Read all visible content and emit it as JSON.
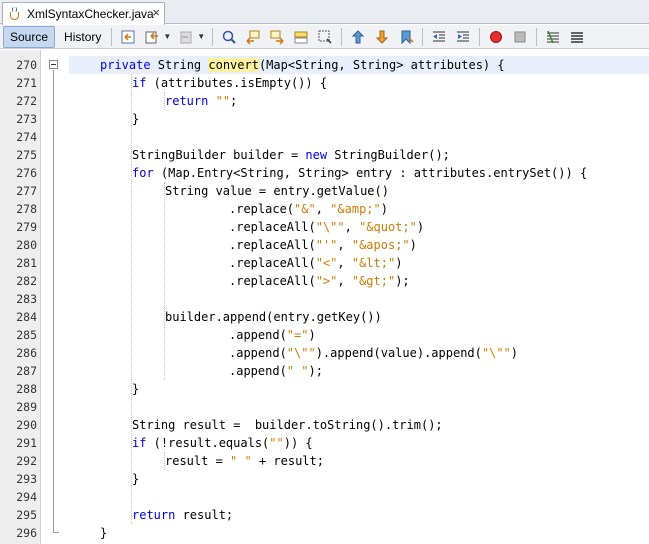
{
  "tab": {
    "title": "XmlSyntaxChecker.java",
    "close": "×"
  },
  "toolbar": {
    "source_label": "Source",
    "history_label": "History"
  },
  "editor": {
    "lines": [
      {
        "n": "270",
        "indent": 1,
        "tokens": [
          [
            "kw",
            "private"
          ],
          [
            "t",
            " String "
          ],
          [
            "hl",
            "convert"
          ],
          [
            "t",
            "(Map<String, String> attributes) {"
          ]
        ]
      },
      {
        "n": "271",
        "indent": 2,
        "tokens": [
          [
            "kw",
            "if"
          ],
          [
            "t",
            " (attributes.isEmpty()) {"
          ]
        ]
      },
      {
        "n": "272",
        "indent": 3,
        "tokens": [
          [
            "kw",
            "return"
          ],
          [
            "t",
            " "
          ],
          [
            "str",
            "\"\""
          ],
          [
            "t",
            ";"
          ]
        ]
      },
      {
        "n": "273",
        "indent": 2,
        "tokens": [
          [
            "t",
            "}"
          ]
        ]
      },
      {
        "n": "274",
        "indent": 0,
        "tokens": []
      },
      {
        "n": "275",
        "indent": 2,
        "tokens": [
          [
            "t",
            "StringBuilder builder = "
          ],
          [
            "kw",
            "new"
          ],
          [
            "t",
            " StringBuilder();"
          ]
        ]
      },
      {
        "n": "276",
        "indent": 2,
        "tokens": [
          [
            "kw",
            "for"
          ],
          [
            "t",
            " (Map.Entry<String, String> entry : attributes.entrySet()) {"
          ]
        ]
      },
      {
        "n": "277",
        "indent": 3,
        "tokens": [
          [
            "t",
            "String value = entry.getValue()"
          ]
        ]
      },
      {
        "n": "278",
        "indent": 5,
        "tokens": [
          [
            "t",
            ".replace("
          ],
          [
            "str",
            "\"&\""
          ],
          [
            "t",
            ", "
          ],
          [
            "str",
            "\"&amp;\""
          ],
          [
            "t",
            ")"
          ]
        ]
      },
      {
        "n": "279",
        "indent": 5,
        "tokens": [
          [
            "t",
            ".replaceAll("
          ],
          [
            "str",
            "\"\\\"\""
          ],
          [
            "t",
            ", "
          ],
          [
            "str",
            "\"&quot;\""
          ],
          [
            "t",
            ")"
          ]
        ]
      },
      {
        "n": "280",
        "indent": 5,
        "tokens": [
          [
            "t",
            ".replaceAll("
          ],
          [
            "str",
            "\"'\""
          ],
          [
            "t",
            ", "
          ],
          [
            "str",
            "\"&apos;\""
          ],
          [
            "t",
            ")"
          ]
        ]
      },
      {
        "n": "281",
        "indent": 5,
        "tokens": [
          [
            "t",
            ".replaceAll("
          ],
          [
            "str",
            "\"<\""
          ],
          [
            "t",
            ", "
          ],
          [
            "str",
            "\"&lt;\""
          ],
          [
            "t",
            ")"
          ]
        ]
      },
      {
        "n": "282",
        "indent": 5,
        "tokens": [
          [
            "t",
            ".replaceAll("
          ],
          [
            "str",
            "\">\""
          ],
          [
            "t",
            ", "
          ],
          [
            "str",
            "\"&gt;\""
          ],
          [
            "t",
            ");"
          ]
        ]
      },
      {
        "n": "283",
        "indent": 0,
        "tokens": []
      },
      {
        "n": "284",
        "indent": 3,
        "tokens": [
          [
            "t",
            "builder.append(entry.getKey())"
          ]
        ]
      },
      {
        "n": "285",
        "indent": 5,
        "tokens": [
          [
            "t",
            ".append("
          ],
          [
            "str",
            "\"=\""
          ],
          [
            "t",
            ")"
          ]
        ]
      },
      {
        "n": "286",
        "indent": 5,
        "tokens": [
          [
            "t",
            ".append("
          ],
          [
            "str",
            "\"\\\"\""
          ],
          [
            "t",
            ").append(value).append("
          ],
          [
            "str",
            "\"\\\"\""
          ],
          [
            "t",
            ")"
          ]
        ]
      },
      {
        "n": "287",
        "indent": 5,
        "tokens": [
          [
            "t",
            ".append("
          ],
          [
            "str",
            "\" \""
          ],
          [
            "t",
            ");"
          ]
        ]
      },
      {
        "n": "288",
        "indent": 2,
        "tokens": [
          [
            "t",
            "}"
          ]
        ]
      },
      {
        "n": "289",
        "indent": 0,
        "tokens": []
      },
      {
        "n": "290",
        "indent": 2,
        "tokens": [
          [
            "t",
            "String result =  builder.toString().trim();"
          ]
        ]
      },
      {
        "n": "291",
        "indent": 2,
        "tokens": [
          [
            "kw",
            "if"
          ],
          [
            "t",
            " (!result.equals("
          ],
          [
            "str",
            "\"\""
          ],
          [
            "t",
            ")) {"
          ]
        ]
      },
      {
        "n": "292",
        "indent": 3,
        "tokens": [
          [
            "t",
            "result = "
          ],
          [
            "str",
            "\" \""
          ],
          [
            "t",
            " + result;"
          ]
        ]
      },
      {
        "n": "293",
        "indent": 2,
        "tokens": [
          [
            "t",
            "}"
          ]
        ]
      },
      {
        "n": "294",
        "indent": 0,
        "tokens": []
      },
      {
        "n": "295",
        "indent": 2,
        "tokens": [
          [
            "kw",
            "return"
          ],
          [
            "t",
            " result;"
          ]
        ]
      },
      {
        "n": "296",
        "indent": 1,
        "tokens": [
          [
            "t",
            "}"
          ]
        ]
      }
    ]
  }
}
